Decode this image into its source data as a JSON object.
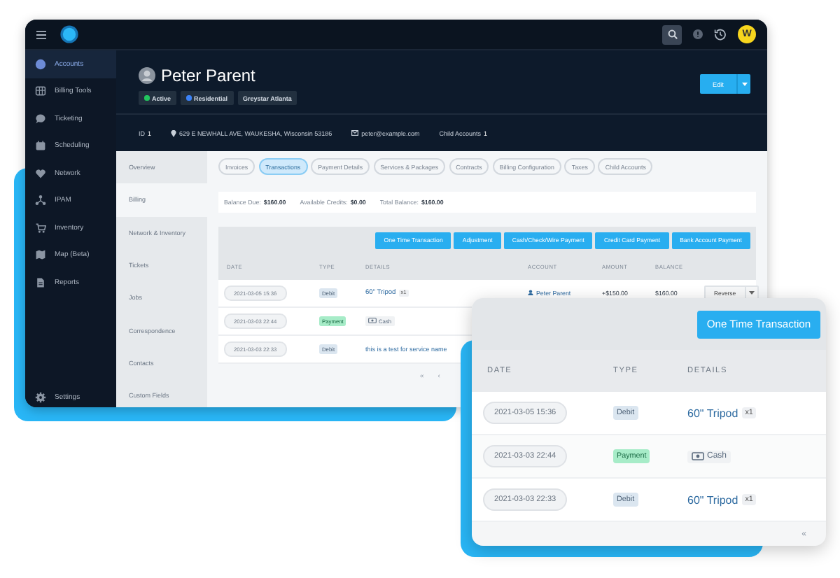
{
  "top_bar": {
    "avatar_letter": "W"
  },
  "sidebar": {
    "items": [
      {
        "label": "Accounts",
        "selected": true
      },
      {
        "label": "Billing Tools",
        "selected": false
      },
      {
        "label": "Ticketing",
        "selected": false
      },
      {
        "label": "Scheduling",
        "selected": false
      },
      {
        "label": "Network",
        "selected": false
      },
      {
        "label": "IPAM",
        "selected": false
      },
      {
        "label": "Inventory",
        "selected": false
      },
      {
        "label": "Map (Beta)",
        "selected": false
      },
      {
        "label": "Reports",
        "selected": false
      }
    ],
    "footer": {
      "label": "Settings"
    }
  },
  "account": {
    "name": "Peter Parent",
    "badges": [
      {
        "label": "Active",
        "color": "#22c55e"
      },
      {
        "label": "Residential",
        "color": "#3b82f6"
      },
      {
        "label": "Greystar Atlanta"
      }
    ],
    "edit_button": "Edit",
    "id_label": "ID",
    "id_value": "1",
    "address": "629 E NEWHALL AVE, WAUKESHA, Wisconsin 53186",
    "email": "peter@example.com",
    "child_accounts_label": "Child Accounts",
    "child_accounts_value": "1"
  },
  "subnav": [
    {
      "label": "Overview",
      "selected": false
    },
    {
      "label": "Billing",
      "selected": true
    },
    {
      "label": "Network & Inventory",
      "selected": false
    },
    {
      "label": "Tickets",
      "selected": false
    },
    {
      "label": "Jobs",
      "selected": false
    },
    {
      "label": "Correspondence",
      "selected": false
    },
    {
      "label": "Contacts",
      "selected": false
    },
    {
      "label": "Custom Fields",
      "selected": false
    }
  ],
  "tabs": [
    {
      "label": "Invoices",
      "selected": false
    },
    {
      "label": "Transactions",
      "selected": true
    },
    {
      "label": "Payment Details",
      "selected": false
    },
    {
      "label": "Services & Packages",
      "selected": false
    },
    {
      "label": "Contracts",
      "selected": false
    },
    {
      "label": "Billing Configuration",
      "selected": false
    },
    {
      "label": "Taxes",
      "selected": false
    },
    {
      "label": "Child Accounts",
      "selected": false
    }
  ],
  "balance": [
    {
      "label": "Balance Due:",
      "value": "$160.00"
    },
    {
      "label": "Available Credits:",
      "value": "$0.00"
    },
    {
      "label": "Total Balance:",
      "value": "$160.00"
    }
  ],
  "transactions": {
    "buttons": [
      "One Time Transaction",
      "Adjustment",
      "Cash/Check/Wire Payment",
      "Credit Card Payment",
      "Bank Account Payment"
    ],
    "columns": [
      "DATE",
      "TYPE",
      "DETAILS",
      "ACCOUNT",
      "AMOUNT",
      "BALANCE"
    ],
    "rows": [
      {
        "date": "2021-03-05 15:36",
        "type": "Debit",
        "kind": "debit",
        "details": {
          "kind": "item",
          "label": "60\" Tripod",
          "quantity": "x1"
        },
        "account": "Peter Parent",
        "amount": "+$150.00",
        "balance": "$160.00",
        "action": "Reverse"
      },
      {
        "date": "2021-03-03 22:44",
        "type": "Payment",
        "kind": "payment",
        "details": {
          "kind": "cash",
          "label": "Cash"
        }
      },
      {
        "date": "2021-03-03 22:33",
        "type": "Debit",
        "kind": "debit",
        "details": {
          "kind": "text",
          "label": "this is a test for service name"
        }
      }
    ],
    "pagination": [
      "«",
      "‹"
    ]
  },
  "zoom_card": {
    "button": "One Time Transaction",
    "columns": [
      "DATE",
      "TYPE",
      "DETAILS"
    ],
    "rows": [
      {
        "date": "2021-03-05 15:36",
        "type": "Debit",
        "kind": "debit",
        "details": {
          "kind": "item",
          "label": "60\" Tripod",
          "quantity": "x1"
        }
      },
      {
        "date": "2021-03-03 22:44",
        "type": "Payment",
        "kind": "payment",
        "details": {
          "kind": "cash",
          "label": "Cash"
        }
      },
      {
        "date": "2021-03-03 22:33",
        "type": "Debit",
        "kind": "debit",
        "details": {
          "kind": "item",
          "label": "60\" Tripod",
          "quantity": "x1"
        }
      }
    ],
    "pagination": [
      "«"
    ]
  }
}
